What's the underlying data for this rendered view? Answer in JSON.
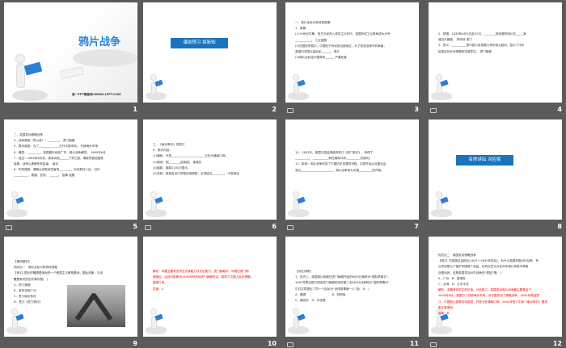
{
  "slides": [
    {
      "number": "1",
      "title": "鸦片战争",
      "footer": "第一PPT模板网-WWW.1PPT.COM"
    },
    {
      "number": "2",
      "banner": "课前预习 探新知"
    },
    {
      "number": "3",
      "lines": [
        "一、鸦片走私与林则徐禁烟",
        "1．背景：",
        "(1)19世纪中期，西方已经进入资本主义时代，英国完成工业革命成为头号",
        "___________。 工业强国",
        "(2)在国际贸易中，中国处于有利的出超地位，为了改变这种不利局面，",
        "英国向中国大量走私______。 鸦片",
        "(3)鸦片走私给中国带来______ 严重危害"
      ]
    },
    {
      "number": "4",
      "lines": [
        "2．禁烟：1839年6月3日至25日，________将收缴的鸦片在_____海",
        "滩当众销毁。 林则徐 虎门",
        "3．意义：__________是中国人民禁烟斗争的伟大胜利，显示了中华",
        "民族反抗外来侵略的坚强意志。 虎门销烟"
      ]
    },
    {
      "number": "5",
      "lines": [
        "二、英国发动侵略战争",
        "4．战争原因（导火线）：________。 虎门销烟",
        "5．根本原因：为了______________打开中国市场。 开辟海外市场",
        "6．爆发：_________，英国舰队驶抵广东，鸦片战争爆发。 1840年6月",
        "7．经过：1842年8月初，英军兵临______下关江面，清政府被迫接受",
        "屈辱，战争以清朝失败结束。 南京",
        "8．失败原因：清朝大多数官员害怕________，对内欺压人民，对外",
        "__________，畏缩，妥协。 ______。 投降 屈服"
      ]
    },
    {
      "number": "6",
      "lines": [
        "三、《南京条约》的签订",
        "9．条约内容：",
        "(1)通商：开放_______________________五处为通商口岸；",
        "(2)割地：割________给英国； 香港岛",
        "(3)赔款：赔款2100万银元。",
        "(4)关税：英商进出口货物应纳税款，必须经过________。 中英商定"
      ]
    },
    {
      "number": "7",
      "lines": [
        "10．1842年，英国又强迫清政府签订《虎门条约》，获得了",
        "__________、___________和在通商口岸__________的权利。",
        "11．影响：鸦片战争改变了中国历史发展的进程，中国开始从封建社会",
        "变为______________________，鸦片战争成为中国_________的开端。"
      ]
    },
    {
      "number": "8",
      "banner": "名师讲坛 对应练"
    },
    {
      "number": "9",
      "lines": [
        "【典例精析】",
        "知识点一　鸦片走私与林则徐禁烟",
        "【例1】图示的雕塑是某地的一个爱国主义教育基地，据此判断，与该",
        "雕塑有关的历史事件是(　)",
        "A．虎门销烟",
        "B．英军攻陷广州",
        "C．签订南京条约",
        "D．签订《虎门条约》"
      ]
    },
    {
      "number": "10",
      "lines": [
        "解析：本题主要考查学生识读能力与识记能力。虎门销烟中，可看出虎门销",
        "烟遗址，由此可推断出1839年林则徐虎门销烟史实，表现了中国人民反侵略，",
        "爱国斗争。",
        "答案：A"
      ]
    },
    {
      "number": "11",
      "lines": [
        "【对应训练】",
        "1．历史上，英国鸦片商贩在虎门销烟开始的6月3日被称为“国际禁毒日”，",
        "1987年联合国又规定虎门销烟完成的第二天6月26日被称为“国际禁毒日”，",
        "它们共同提出了同一个目标为“全球禁毒第一人”的(　B　)",
        "A．魏源　　　　　　　　　B．林则徐",
        "C．龚自珍　D．邓世昌"
      ]
    },
    {
      "number": "12",
      "lines": [
        "知识点二　英国发动侵略战争",
        "【例2】在英国议会辩论(1821～1830年前后)，为什么英国采取对华战争，有",
        "议员说是为了保护本国商人利益，也有议员认为在对华鸦片贸易中获取",
        "巨额利润，这是英国发动对华战争的“原因”是(　)",
        "A．广州　B．香港岛",
        "C．台湾　D．辽东半岛",
        "解析：本题考查学生的识读、分析能力。英国发动鸦片战争最主要是由于",
        "1840年6月，英国为了开辟海外市场，对中国发动了侵略战争。1842年被迫签",
        "订，中国割让香港岛给英国，开放五处通商口岸。1842年签订中英《南京条约》要求",
        "割让香港岛。",
        "答案：B"
      ]
    }
  ]
}
